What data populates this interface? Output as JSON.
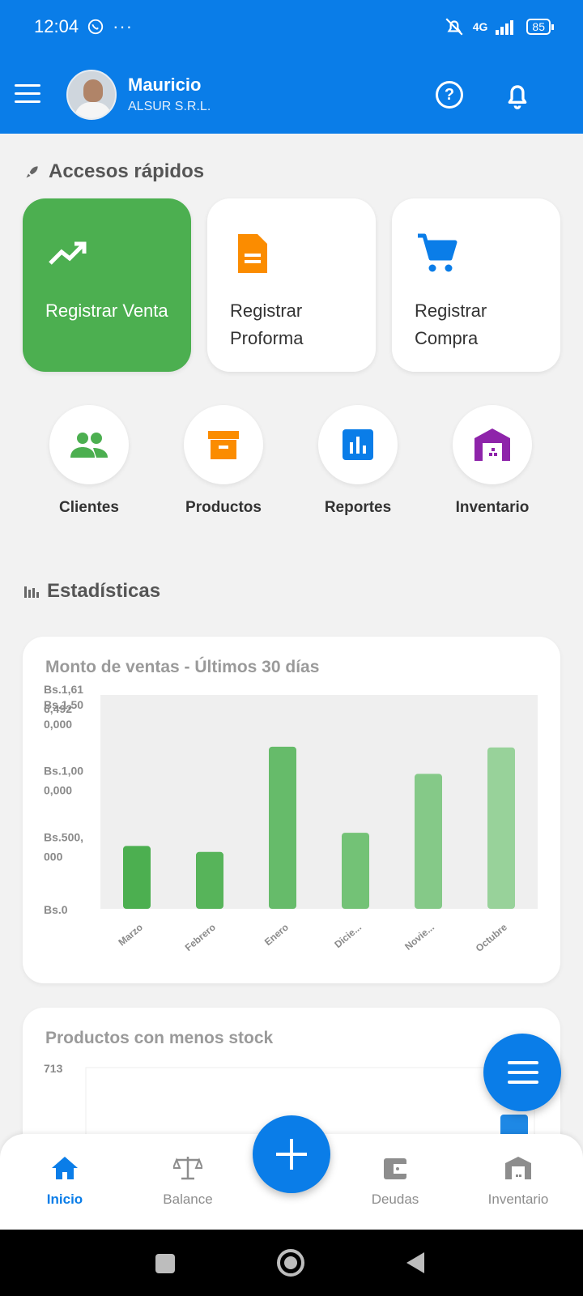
{
  "status_bar": {
    "time": "12:04",
    "network": "4G",
    "battery": "85"
  },
  "header": {
    "user_name": "Mauricio",
    "company": "ALSUR S.R.L."
  },
  "quick_access": {
    "title": "Accesos rápidos",
    "tiles": [
      {
        "label": "Registrar Venta"
      },
      {
        "label": "Registrar Proforma"
      },
      {
        "label": "Registrar Compra"
      }
    ],
    "shortcuts": [
      {
        "label": "Clientes"
      },
      {
        "label": "Productos"
      },
      {
        "label": "Reportes"
      },
      {
        "label": "Inventario"
      }
    ]
  },
  "stats": {
    "title": "Estadísticas"
  },
  "chart_data": [
    {
      "type": "bar",
      "title": "Monto de ventas - Últimos 30 días",
      "categories": [
        "Marzo",
        "Febrero",
        "Enero",
        "Dicie...",
        "Novie...",
        "Octubre"
      ],
      "values": [
        475000,
        430000,
        1225000,
        575000,
        1020000,
        1220000
      ],
      "y_tick_labels": [
        "Bs.1,61 6,492",
        "Bs.1,50 0,000",
        "Bs.1,00 0,000",
        "Bs.500, 000",
        "Bs.0"
      ],
      "ylim": [
        0,
        1616492
      ],
      "colors": [
        "#4caf50",
        "#57b45a",
        "#66bb6a",
        "#73c276",
        "#85c988",
        "#98d29a"
      ]
    },
    {
      "type": "bar",
      "title": "Productos con menos stock",
      "y_tick_labels": [
        "713"
      ]
    }
  ],
  "fab": {
    "menu": "menu-icon",
    "add": "plus-icon"
  },
  "bottom_nav": [
    {
      "label": "Inicio",
      "active": true
    },
    {
      "label": "Balance",
      "active": false
    },
    {
      "label": "Deudas",
      "active": false
    },
    {
      "label": "Inventario",
      "active": false
    }
  ],
  "colors": {
    "primary": "#0a7de8",
    "green": "#4caf50",
    "orange": "#fb8c00",
    "purple": "#8e24aa"
  }
}
